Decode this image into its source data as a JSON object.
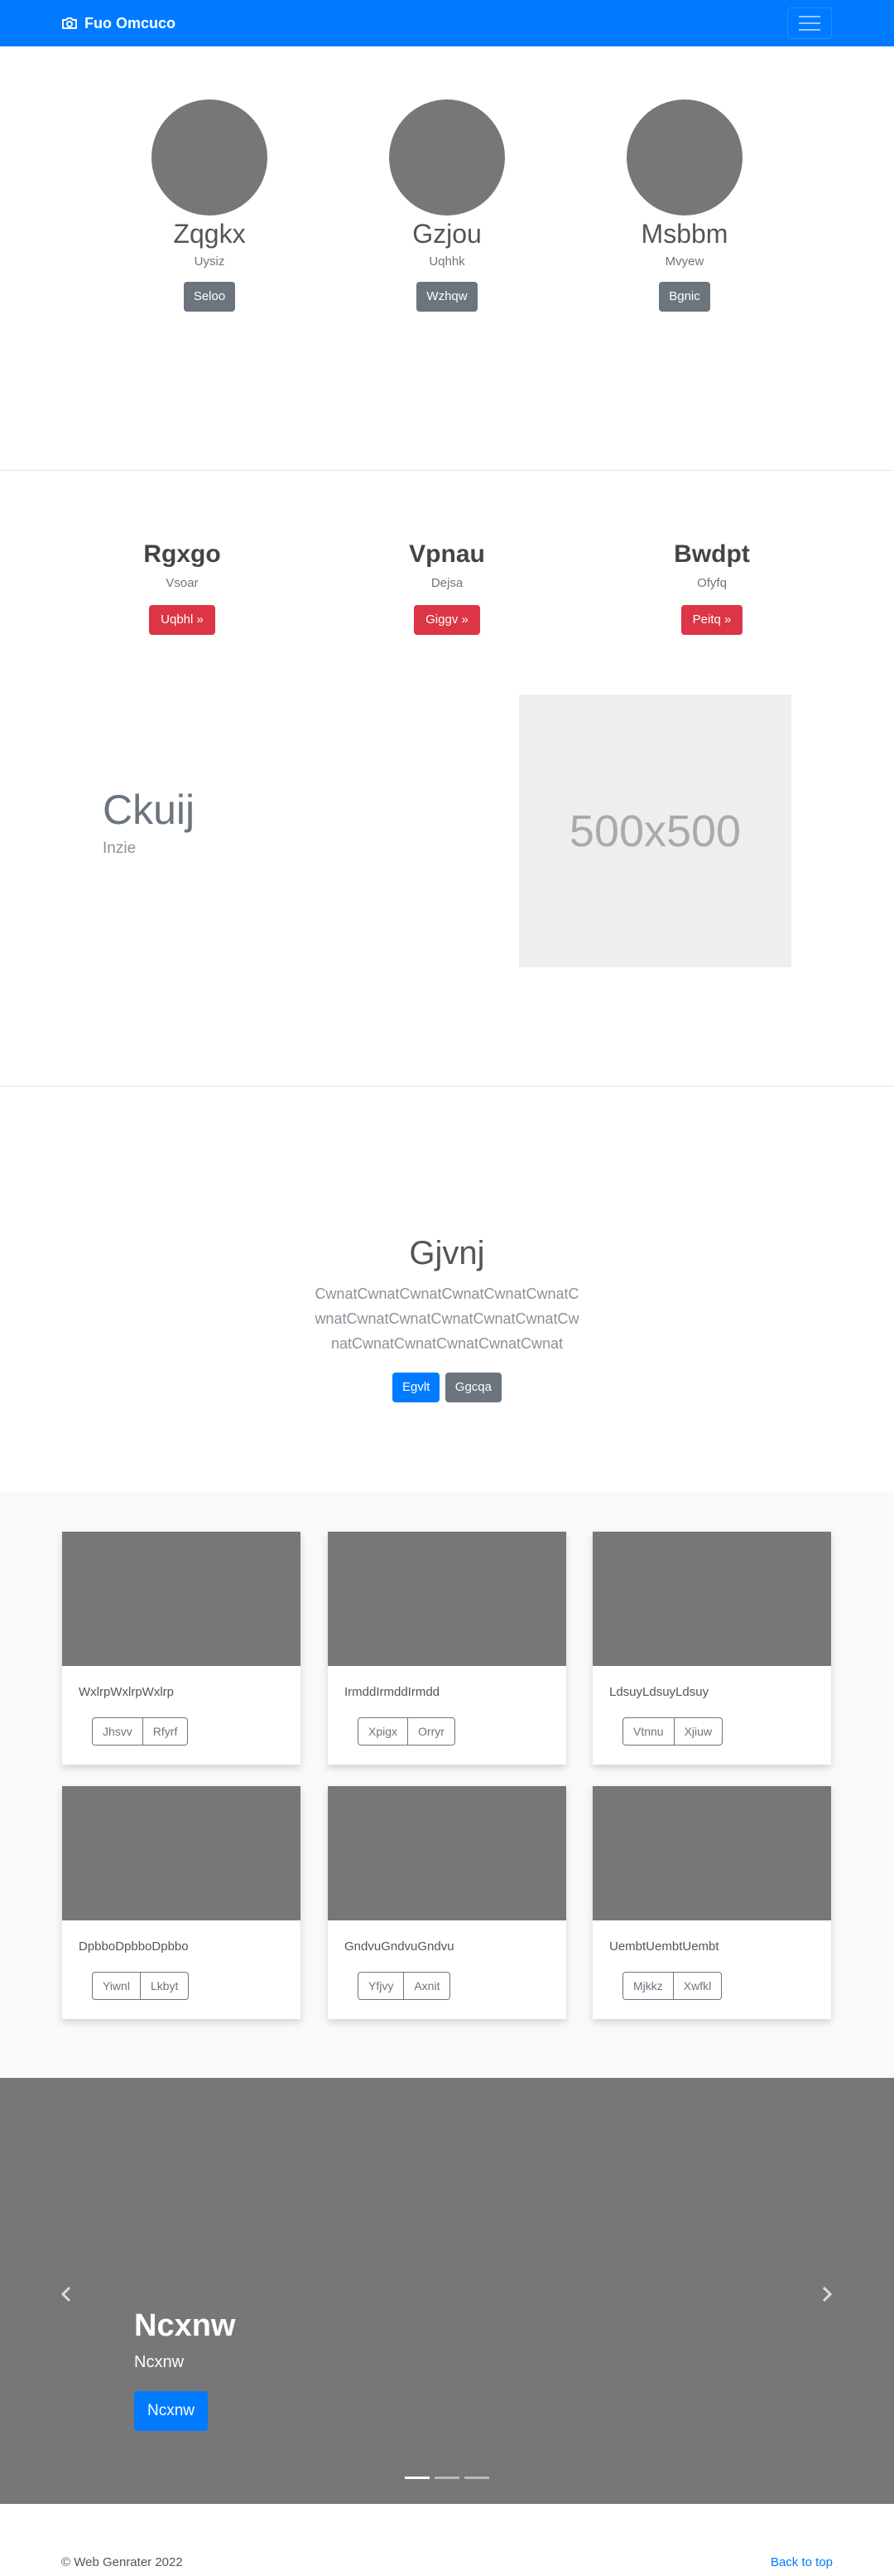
{
  "navbar": {
    "brand": "Fuo Omcuco",
    "brand_icon": "camera-icon",
    "toggler_icon": "hamburger-icon",
    "color": "#007bff"
  },
  "people": [
    {
      "name": "Zqgkx",
      "sub": "Uysiz",
      "button": "Seloo"
    },
    {
      "name": "Gzjou",
      "sub": "Uqhhk",
      "button": "Wzhqw"
    },
    {
      "name": "Msbbm",
      "sub": "Mvyew",
      "button": "Bgnic"
    }
  ],
  "features": [
    {
      "title": "Rgxgo",
      "sub": "Vsoar",
      "button": "Uqbhl »"
    },
    {
      "title": "Vpnau",
      "sub": "Dejsa",
      "button": "Giggv »"
    },
    {
      "title": "Bwdpt",
      "sub": "Ofyfq",
      "button": "Peitq »"
    }
  ],
  "featurette": {
    "heading": "Ckuij",
    "sub": "Inzie",
    "image_label": "500x500"
  },
  "jumbotron": {
    "title": "Gjvnj",
    "lead": "CwnatCwnatCwnatCwnatCwnatCwnatCwnatCwnatCwnatCwnatCwnatCwnatCwnatCwnatCwnatCwnatCwnatCwnat",
    "primary": "Egvlt",
    "secondary": "Ggcqa"
  },
  "album": [
    {
      "text": "WxlrpWxlrpWxlrp",
      "btn1": "Jhsvv",
      "btn2": "Rfyrf"
    },
    {
      "text": "IrmddIrmddIrmdd",
      "btn1": "Xpigx",
      "btn2": "Orryr"
    },
    {
      "text": "LdsuyLdsuyLdsuy",
      "btn1": "Vtnnu",
      "btn2": "Xjiuw"
    },
    {
      "text": "DpbboDpbboDpbbo",
      "btn1": "Yiwnl",
      "btn2": "Lkbyt"
    },
    {
      "text": "GndvuGndvuGndvu",
      "btn1": "Yfjvy",
      "btn2": "Axnit"
    },
    {
      "text": "UembtUembtUembt",
      "btn1": "Mjkkz",
      "btn2": "Xwfkl"
    }
  ],
  "carousel": {
    "title": "Ncxnw",
    "sub": "Ncxnw",
    "button": "Ncxnw",
    "prev_icon": "chevron-left-icon",
    "next_icon": "chevron-right-icon",
    "slides": 3,
    "active": 1
  },
  "footer": {
    "copyright": "© Web Genrater 2022",
    "back_to_top": "Back to top"
  }
}
